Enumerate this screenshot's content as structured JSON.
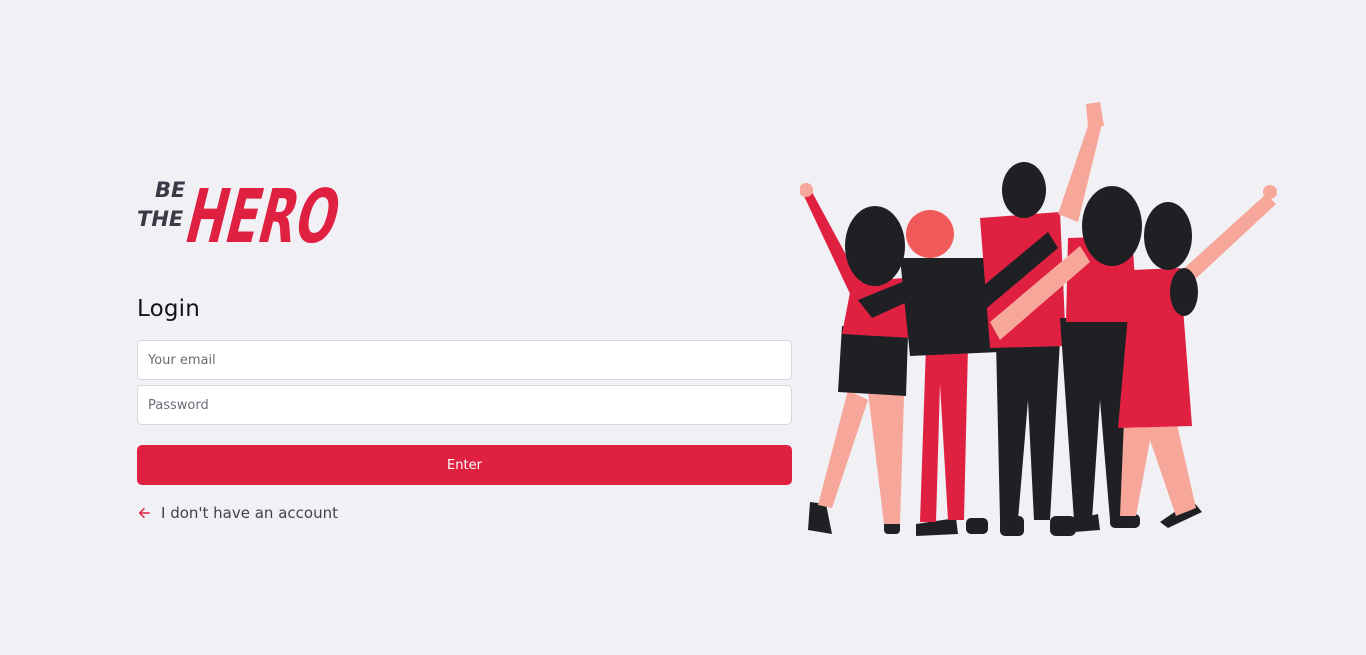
{
  "logo": {
    "line1": "BE",
    "line2": "THE",
    "brand": "HERO"
  },
  "login": {
    "title": "Login",
    "email_placeholder": "Your email",
    "password_placeholder": "Password",
    "enter_label": "Enter",
    "register_link": "I don't have an account"
  },
  "illustration": {
    "name": "group-of-heroes-illustration"
  },
  "colors": {
    "brand": "#e02041",
    "background": "#f0f0f5",
    "text": "#41414d",
    "dark": "#1f2024",
    "skin": "#f7a79a"
  }
}
